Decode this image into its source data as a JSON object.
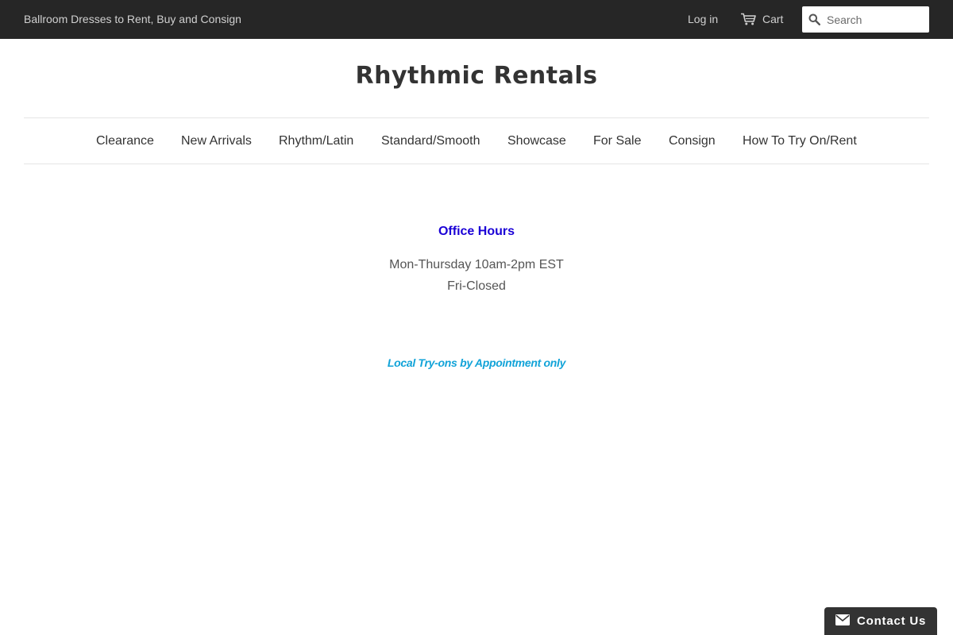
{
  "topbar": {
    "tagline": "Ballroom Dresses to Rent, Buy and Consign",
    "login_label": "Log in",
    "cart_label": "Cart",
    "cart_icon": "cart-icon",
    "search_icon": "search-icon",
    "search_placeholder": "Search",
    "search_value": "",
    "background_color": "#262626"
  },
  "site": {
    "title": "Rhythmic Rentals"
  },
  "nav": {
    "items": [
      {
        "label": "Clearance"
      },
      {
        "label": "New Arrivals"
      },
      {
        "label": "Rhythm/Latin"
      },
      {
        "label": "Standard/Smooth"
      },
      {
        "label": "Showcase"
      },
      {
        "label": "For Sale"
      },
      {
        "label": "Consign"
      },
      {
        "label": "How To Try On/Rent"
      }
    ]
  },
  "main": {
    "office_title": "Office Hours",
    "hours": [
      "Mon-Thursday 10am-2pm EST",
      "Fri-Closed"
    ],
    "tryons_note": "Local Try-ons by Appointment only",
    "office_title_color": "#1a00d6",
    "tryons_color": "#11a3d8"
  },
  "contact_widget": {
    "label": "Contact Us",
    "icon": "envelope-icon"
  }
}
